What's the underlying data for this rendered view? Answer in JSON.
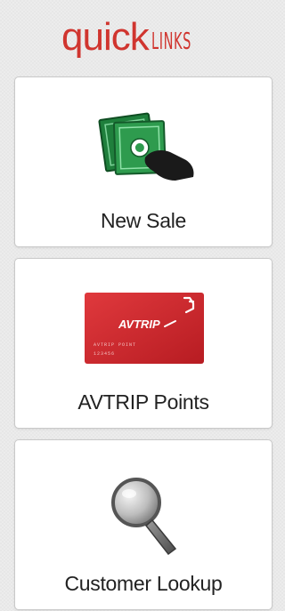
{
  "header": {
    "logo_quick": "quick",
    "logo_links": "LINKS"
  },
  "cards": [
    {
      "label": "New Sale",
      "icon": "money-hand-icon"
    },
    {
      "label": "AVTRIP Points",
      "icon": "avtrip-card-icon",
      "card_brand": "AVTRIP",
      "card_line1": "AVTRIP POINT",
      "card_line2": "123456"
    },
    {
      "label": "Customer Lookup",
      "icon": "magnifying-glass-icon"
    }
  ],
  "colors": {
    "brand_red": "#d0352f",
    "card_red": "#d1252a",
    "cash_green": "#2e9b4e",
    "background": "#ececec"
  }
}
